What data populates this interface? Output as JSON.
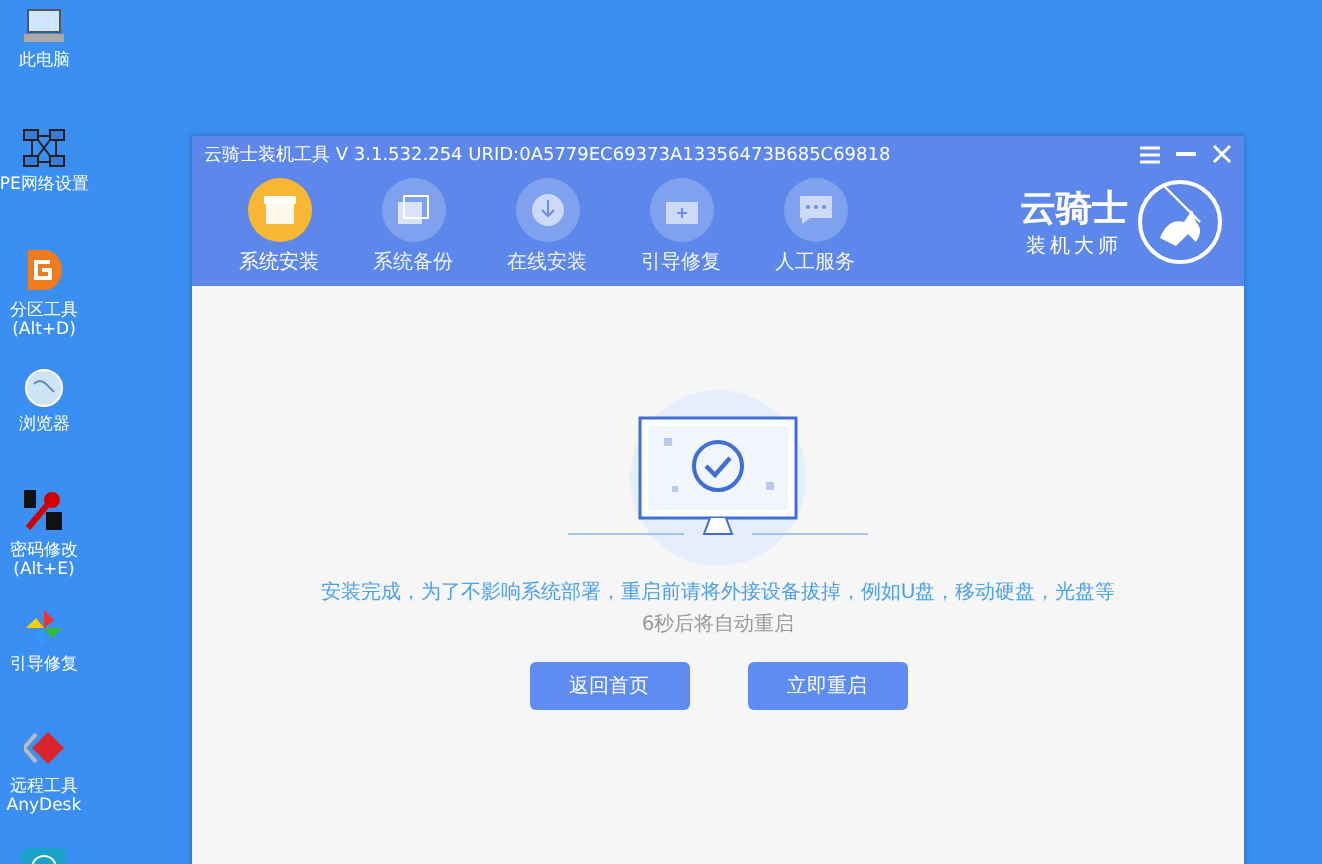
{
  "desktop_icons": [
    {
      "kind": "computer",
      "label": "此电脑"
    },
    {
      "kind": "network",
      "label": "PE网络设置"
    },
    {
      "kind": "partition",
      "label": "分区工具\n(Alt+D)"
    },
    {
      "kind": "browser",
      "label": "浏览器"
    },
    {
      "kind": "password",
      "label": "密码修改\n(Alt+E)"
    },
    {
      "kind": "pinwheel",
      "label": "引导修复"
    },
    {
      "kind": "remote",
      "label": "远程工具\nAnyDesk"
    },
    {
      "kind": "gauge"
    }
  ],
  "window": {
    "title": "云骑士装机工具 V 3.1.532.254 URID:0A5779EC69373A13356473B685C69818",
    "logo_title": "云骑士",
    "logo_subtitle": "装机大师"
  },
  "tabs": [
    {
      "kind": "install",
      "label": "系统安装",
      "selected": true
    },
    {
      "kind": "backup",
      "label": "系统备份",
      "selected": false
    },
    {
      "kind": "online",
      "label": "在线安装",
      "selected": false
    },
    {
      "kind": "repair",
      "label": "引导修复",
      "selected": false
    },
    {
      "kind": "service",
      "label": "人工服务",
      "selected": false
    }
  ],
  "message": "安装完成，为了不影响系统部署，重启前请将外接设备拔掉，例如U盘，移动硬盘，光盘等",
  "countdown": "6秒后将自动重启",
  "buttons": [
    "返回首页",
    "立即重启"
  ]
}
